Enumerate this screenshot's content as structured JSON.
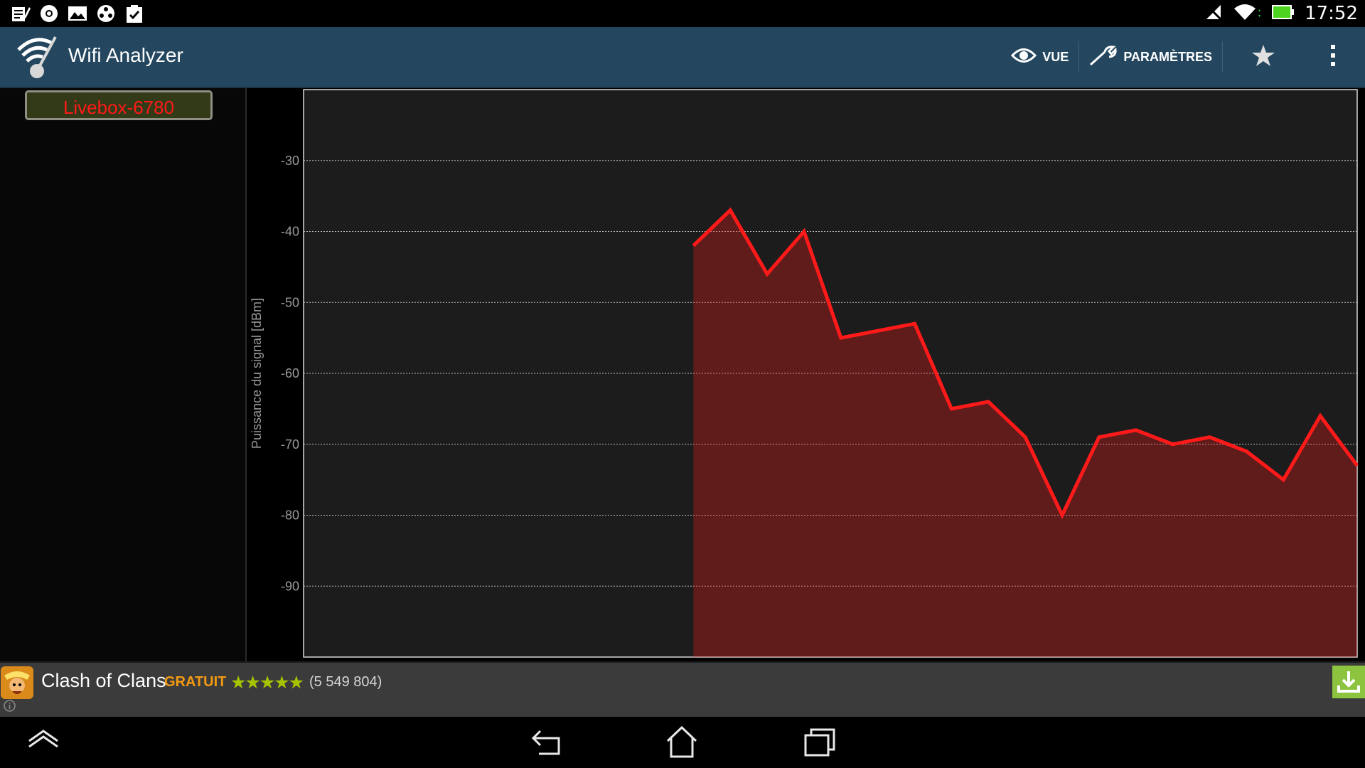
{
  "status_bar": {
    "time": "17:52",
    "left_icons": [
      "notes-icon",
      "chrome-icon",
      "gallery-icon",
      "media-icon",
      "clipboard-check-icon"
    ],
    "right_icons": [
      "signal-muted-icon",
      "wifi-icon",
      "battery-icon"
    ]
  },
  "app_bar": {
    "title": "Wifi Analyzer",
    "actions": {
      "view_label": "VUE",
      "settings_label": "PARAMÈTRES"
    }
  },
  "network": {
    "ssid": "Livebox-6780",
    "color": "#ff1a1a"
  },
  "chart_data": {
    "type": "area",
    "ylabel": "Puissance du signal [dBm]",
    "ylim": [
      -100,
      -20
    ],
    "yticks": [
      -30,
      -40,
      -50,
      -60,
      -70,
      -80,
      -90
    ],
    "grid": true,
    "series": [
      {
        "name": "Livebox-6780",
        "color": "#ff1a1a",
        "x": [
          0,
          1,
          2,
          3,
          4,
          5,
          6,
          7,
          8,
          9,
          10,
          11,
          12,
          13,
          14,
          15,
          16,
          17,
          18
        ],
        "values": [
          -42,
          -37,
          -46,
          -40,
          -55,
          -54,
          -53,
          -65,
          -64,
          -69,
          -80,
          -69,
          -68,
          -70,
          -69,
          -71,
          -75,
          -66,
          -73
        ]
      }
    ],
    "x_window": 30
  },
  "ad": {
    "title": "Clash of Clans",
    "price": "GRATUIT",
    "stars": "★★★★★",
    "rating_value": 4.5,
    "count": "(5 549 804)"
  },
  "nav_bar": {
    "buttons": [
      "hide-keyboard-icon",
      "back-icon",
      "home-icon",
      "recent-apps-icon"
    ]
  }
}
